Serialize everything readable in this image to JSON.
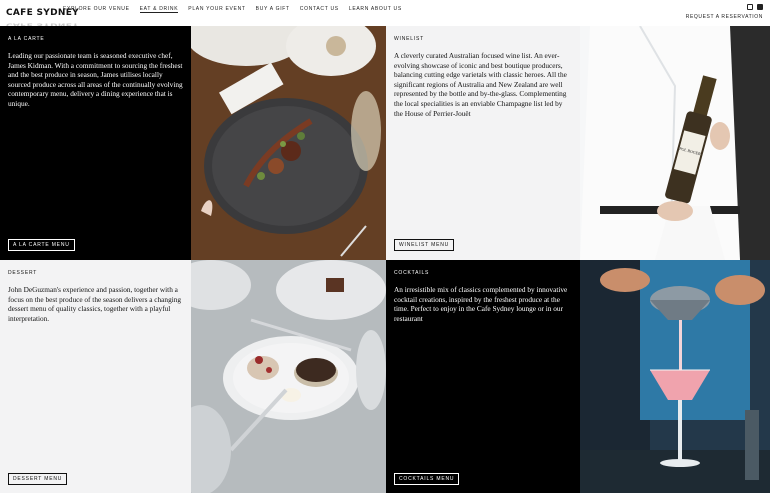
{
  "header": {
    "logo": "CAFE SYDNEY",
    "nav": [
      "EXPLORE OUR VENUE",
      "EAT & DRINK",
      "PLAN YOUR EVENT",
      "BUY A GIFT",
      "CONTACT US",
      "LEARN ABOUT US"
    ],
    "active_nav": "EAT & DRINK",
    "social": [
      "instagram-icon",
      "facebook-icon"
    ],
    "reserve": "REQUEST A RESERVATION"
  },
  "sections": {
    "a_la_carte": {
      "title": "A LA CARTE",
      "body": "Leading our passionate team is seasoned executive chef, James Kidman. With a commitment to sourcing the freshest and the best produce in season, James utilises locally sourced produce across all areas of the continually evolving contemporary menu, delivery a dining experience that is unique.",
      "button": "A LA CARTE MENU"
    },
    "winelist": {
      "title": "WINELIST",
      "body": "A cleverly curated Australian focused wine list. An ever-evolving showcase of iconic and best boutique producers, balancing cutting edge varietals with classic heroes. All the significant regions of Australia and New Zealand are well represented by the bottle and by-the-glass. Complementing the local specialities is an enviable Champagne list led by the House of Perrier-Jouët",
      "button": "WINELIST MENU"
    },
    "dessert": {
      "title": "DESSERT",
      "body": "John DeGuzman's experience and passion, together with a focus on the best produce of the season delivers a changing dessert menu of quality classics, together with a playful interpretation.",
      "button": "DESSERT MENU"
    },
    "cocktails": {
      "title": "COCKTAILS",
      "body": "An irresistible mix of classics complemented by innovative cocktail creations, inspired by the freshest produce at the time. Perfect to enjoy in the Cafe Sydney lounge or in our restaurant",
      "button": "COCKTAILS MENU"
    }
  },
  "wine_label": "POL ROGER"
}
